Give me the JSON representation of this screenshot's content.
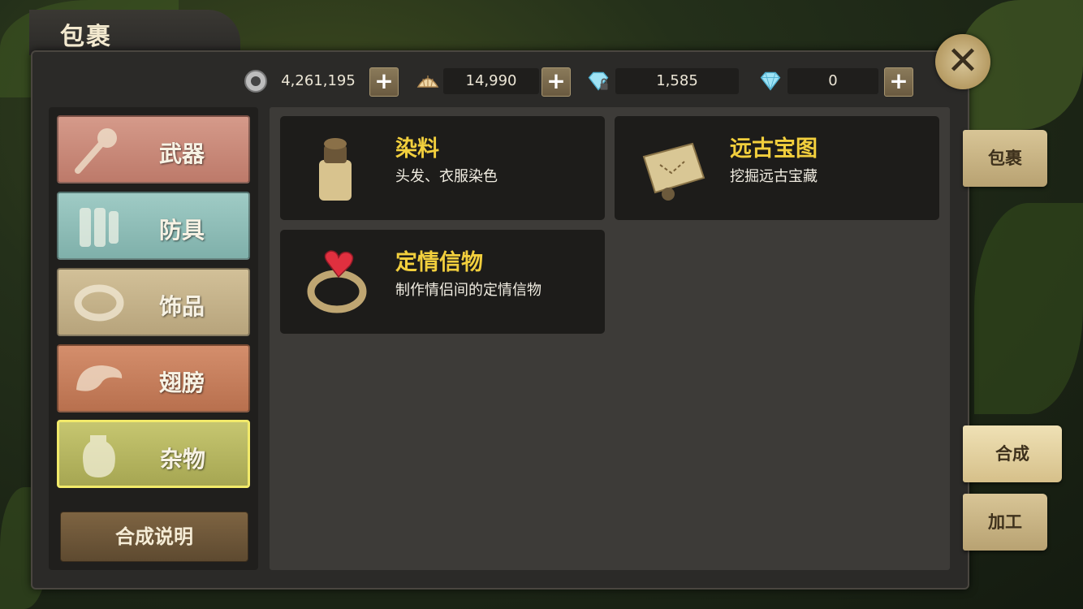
{
  "title": "包裹",
  "currencies": [
    {
      "icon": "silver-coin-icon",
      "value": "4,261,195",
      "has_plus": true
    },
    {
      "icon": "shell-icon",
      "value": "14,990",
      "has_plus": true
    },
    {
      "icon": "locked-diamond-icon",
      "value": "1,585",
      "has_plus": false
    },
    {
      "icon": "diamond-icon",
      "value": "0",
      "has_plus": true
    }
  ],
  "plus_label": "+",
  "close_label": "✕",
  "categories": [
    {
      "label": "武器",
      "icon": "mace-icon",
      "color": "#c98676",
      "selected": false
    },
    {
      "label": "防具",
      "icon": "armor-icon",
      "color": "#8fbcb6",
      "selected": false
    },
    {
      "label": "饰品",
      "icon": "bracelet-icon",
      "color": "#c6b28a",
      "selected": false
    },
    {
      "label": "翅膀",
      "icon": "wing-icon",
      "color": "#c7805e",
      "selected": false
    },
    {
      "label": "杂物",
      "icon": "jar-icon",
      "color": "#b5b561",
      "selected": true
    }
  ],
  "help_button": "合成说明",
  "items": [
    {
      "name": "染料",
      "desc": "头发、衣服染色",
      "icon": "dye-bottle-icon"
    },
    {
      "name": "远古宝图",
      "desc": "挖掘远古宝藏",
      "icon": "treasure-map-icon"
    },
    {
      "name": "定情信物",
      "desc": "制作情侣间的定情信物",
      "icon": "heart-ring-icon"
    }
  ],
  "side_tabs": [
    {
      "label": "包裹",
      "active": false
    },
    {
      "label": "合成",
      "active": true
    },
    {
      "label": "加工",
      "active": false
    }
  ]
}
